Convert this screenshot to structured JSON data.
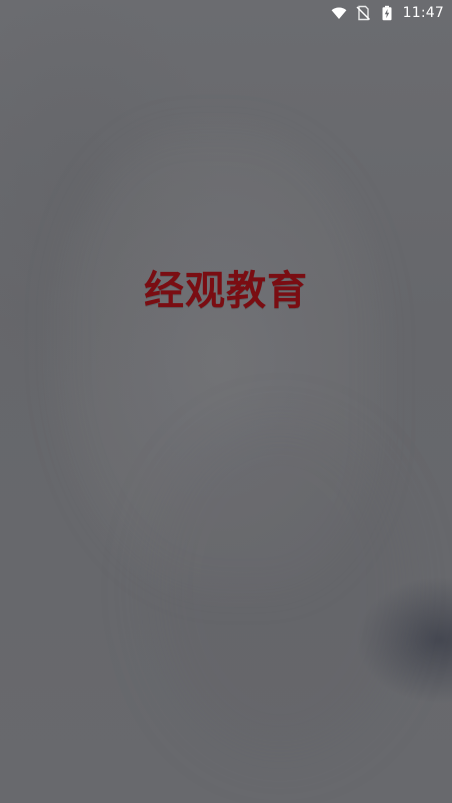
{
  "status_bar": {
    "time": "11:47",
    "icons": [
      "wifi-icon",
      "no-sim-icon",
      "battery-charging-icon"
    ],
    "icon_color": "#ffffff"
  },
  "splash": {
    "title": "经观教育",
    "title_color": "#7a0d12",
    "background_color": "#67686c"
  }
}
